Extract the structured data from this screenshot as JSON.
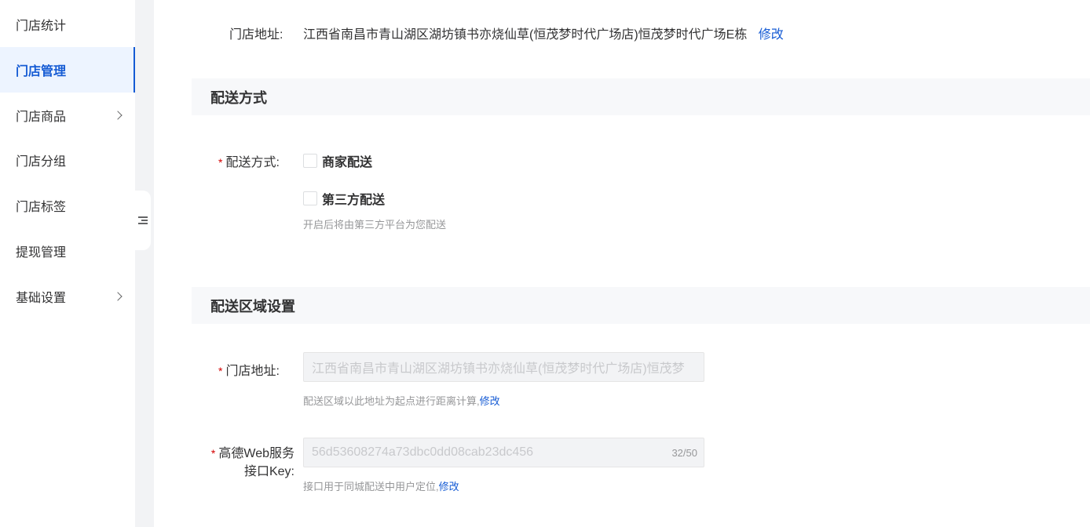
{
  "sidebar": {
    "items": [
      {
        "label": "门店统计",
        "active": false,
        "has_chevron": false
      },
      {
        "label": "门店管理",
        "active": true,
        "has_chevron": false
      },
      {
        "label": "门店商品",
        "active": false,
        "has_chevron": true
      },
      {
        "label": "门店分组",
        "active": false,
        "has_chevron": false
      },
      {
        "label": "门店标签",
        "active": false,
        "has_chevron": false
      },
      {
        "label": "提现管理",
        "active": false,
        "has_chevron": false
      },
      {
        "label": "基础设置",
        "active": false,
        "has_chevron": true
      }
    ]
  },
  "store_address": {
    "label": "门店地址:",
    "value": "江西省南昌市青山湖区湖坊镇书亦烧仙草(恒茂梦时代广场店)恒茂梦时代广场E栋",
    "edit_link": "修改"
  },
  "delivery_section": {
    "title": "配送方式",
    "field_label": "配送方式:",
    "options": [
      {
        "label": "商家配送",
        "checked": false
      },
      {
        "label": "第三方配送",
        "checked": false
      }
    ],
    "help": "开启后将由第三方平台为您配送"
  },
  "area_section": {
    "title": "配送区域设置",
    "address_label": "门店地址:",
    "address_value": "江西省南昌市青山湖区湖坊镇书亦烧仙草(恒茂梦时代广场店)恒茂梦",
    "address_help": "配送区域以此地址为起点进行距离计算,",
    "address_help_link": "修改",
    "key_label_line1": "高德Web服务",
    "key_label_line2": "接口Key:",
    "key_value": "56d53608274a73dbc0dd08cab23dc456",
    "key_count": "32/50",
    "key_help": "接口用于同城配送中用户定位,",
    "key_help_link": "修改"
  },
  "colors": {
    "accent": "#155bd4",
    "required": "#d40000",
    "section_bg": "#f7f8fa",
    "page_gutter": "#f2f3f5"
  }
}
